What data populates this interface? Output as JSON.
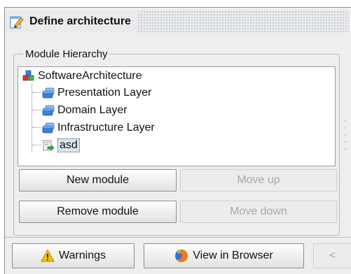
{
  "window": {
    "title": "Define architecture",
    "icon": "edit-pencil-icon"
  },
  "hierarchy": {
    "legend": "Module Hierarchy",
    "root": {
      "label": "SoftwareArchitecture",
      "icon": "architecture-cubes-icon"
    },
    "children": [
      {
        "label": "Presentation Layer",
        "icon": "layer-icon"
      },
      {
        "label": "Domain Layer",
        "icon": "layer-icon"
      },
      {
        "label": "Infrastructure Layer",
        "icon": "layer-icon"
      },
      {
        "label": "asd",
        "icon": "module-arrow-icon",
        "selected": true
      }
    ]
  },
  "buttons": {
    "new_module": "New module",
    "move_up": "Move up",
    "remove_module": "Remove module",
    "move_down": "Move down"
  },
  "footer": {
    "warnings": "Warnings",
    "view_in_browser": "View in Browser",
    "back": "<"
  },
  "colors": {
    "selection": "#dce6f2",
    "layer_blue": "#3b7fd6",
    "warning_yellow": "#f4c20d"
  }
}
